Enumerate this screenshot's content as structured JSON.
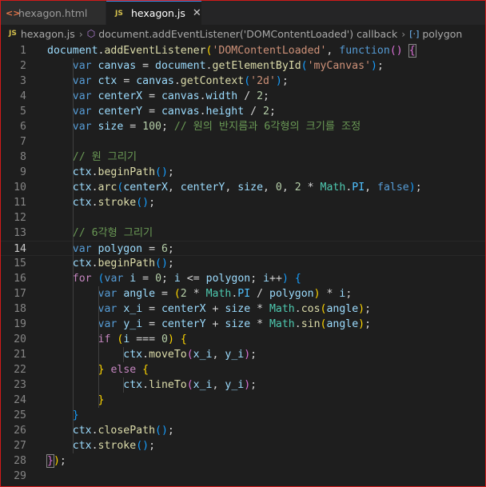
{
  "tabs": [
    {
      "icon": "<>",
      "label": "hexagon.html",
      "active": false
    },
    {
      "icon": "JS",
      "label": "hexagon.js",
      "active": true,
      "close": "✕"
    }
  ],
  "breadcrumb": {
    "file": "hexagon.js",
    "callback": "document.addEventListener('DOMContentLoaded') callback",
    "symbol": "polygon"
  },
  "editor": {
    "language": "javascript",
    "active_line": 14,
    "lines": [
      "document.addEventListener('DOMContentLoaded', function() {",
      "    var canvas = document.getElementById('myCanvas');",
      "    var ctx = canvas.getContext('2d');",
      "    var centerX = canvas.width / 2;",
      "    var centerY = canvas.height / 2;",
      "    var size = 100; // 원의 반지름과 6각형의 크기를 조정",
      "",
      "    // 원 그리기",
      "    ctx.beginPath();",
      "    ctx.arc(centerX, centerY, size, 0, 2 * Math.PI, false);",
      "    ctx.stroke();",
      "",
      "    // 6각형 그리기",
      "    var polygon = 6;",
      "    ctx.beginPath();",
      "    for (var i = 0; i <= polygon; i++) {",
      "        var angle = (2 * Math.PI / polygon) * i;",
      "        var x_i = centerX + size * Math.cos(angle);",
      "        var y_i = centerY + size * Math.sin(angle);",
      "        if (i === 0) {",
      "            ctx.moveTo(x_i, y_i);",
      "        } else {",
      "            ctx.lineTo(x_i, y_i);",
      "        }",
      "    }",
      "    ctx.closePath();",
      "    ctx.stroke();",
      "});",
      ""
    ]
  },
  "colors": {
    "background": "#1e1e1e",
    "frame_border": "#d11a1a",
    "active_tab_top": "#3b8eea"
  }
}
